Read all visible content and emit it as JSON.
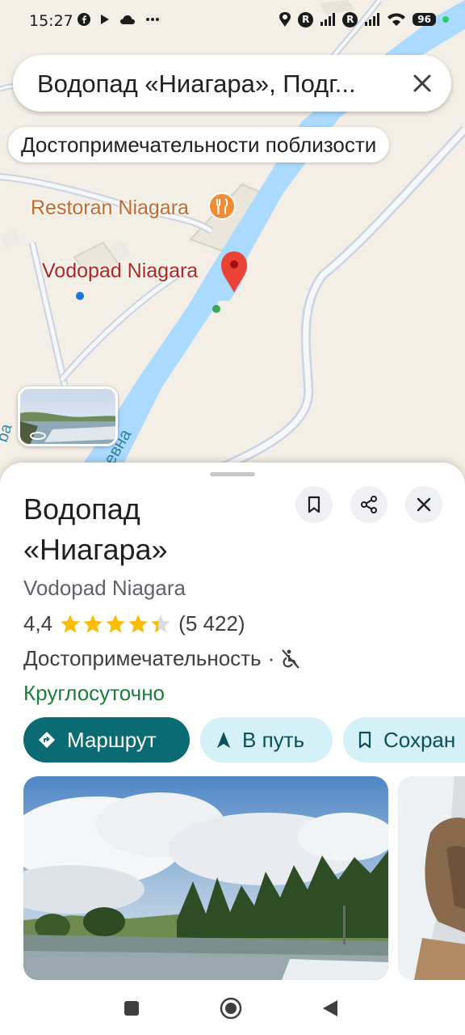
{
  "status_bar": {
    "time": "15:27",
    "left_icons": [
      "facebook-icon",
      "play-icon",
      "cloud-icon",
      "more-dots-icon"
    ],
    "right_icons": [
      "location-icon",
      "roaming-icon",
      "signal-icon",
      "wifi-icon",
      "battery-icon"
    ],
    "roaming_label": "R",
    "battery": "96"
  },
  "search": {
    "query": "Водопад «Ниагара», Подг..."
  },
  "chip": {
    "label": "Достопримечательности поблизости"
  },
  "map": {
    "restaurant_label": "Restoran Niagara",
    "place_label": "Vodopad Niagara",
    "road_label": "ба",
    "river_label": "евна",
    "water_color": "#aadaff",
    "road_color": "#c9d3e3",
    "pin_color": "#ea4335",
    "restaurant_color": "#f28b32"
  },
  "place": {
    "title_line1": "Водопад",
    "title_line2": "«Ниагара»",
    "subtitle": "Vodopad Niagara",
    "rating": "4,4",
    "rating_value": 4.4,
    "reviews": "(5 422)",
    "category": "Достопримечательность",
    "separator": "·",
    "accessibility_icon": "no-wheelchair-icon",
    "hours": "Круглосуточно",
    "star_color": "#fbbc04"
  },
  "actions": {
    "route": "Маршрут",
    "start": "В путь",
    "save": "Сохран"
  },
  "nav": {
    "buttons": [
      "recents-button",
      "home-button",
      "back-button"
    ]
  }
}
